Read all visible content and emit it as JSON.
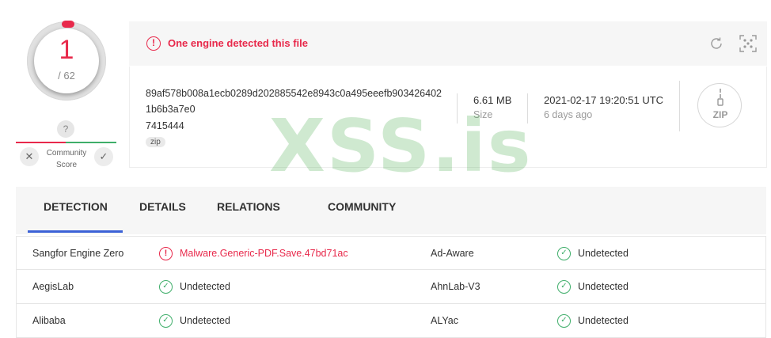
{
  "score": {
    "detections": "1",
    "total": "/ 62"
  },
  "community": {
    "question": "?",
    "label_line1": "Community",
    "label_line2": "Score",
    "downvote": "✕",
    "upvote": "✓"
  },
  "banner": {
    "alert_glyph": "!",
    "text": "One engine detected this file"
  },
  "file": {
    "hash": "89af578b008a1ecb0289d202885542e8943c0a495eeefb9034264021b6b3a7e0",
    "name": "7415444",
    "tag": "zip",
    "size": "6.61 MB",
    "size_label": "Size",
    "date": "2021-02-17 19:20:51 UTC",
    "date_ago": "6 days ago",
    "type_badge": "ZIP"
  },
  "watermark": "XSS.is",
  "tabs": [
    "DETECTION",
    "DETAILS",
    "RELATIONS",
    "COMMUNITY"
  ],
  "rows": [
    {
      "left_engine": "Sangfor Engine Zero",
      "left_result": "Malware.Generic-PDF.Save.47bd71ac",
      "left_status": "malicious",
      "right_engine": "Ad-Aware",
      "right_result": "Undetected",
      "right_status": "clean"
    },
    {
      "left_engine": "AegisLab",
      "left_result": "Undetected",
      "left_status": "clean",
      "right_engine": "AhnLab-V3",
      "right_result": "Undetected",
      "right_status": "clean"
    },
    {
      "left_engine": "Alibaba",
      "left_result": "Undetected",
      "left_status": "clean",
      "right_engine": "ALYac",
      "right_result": "Undetected",
      "right_status": "clean"
    }
  ],
  "colors": {
    "malicious": "#e8294b",
    "clean": "#3fae6a",
    "accent": "#3b61d6"
  }
}
